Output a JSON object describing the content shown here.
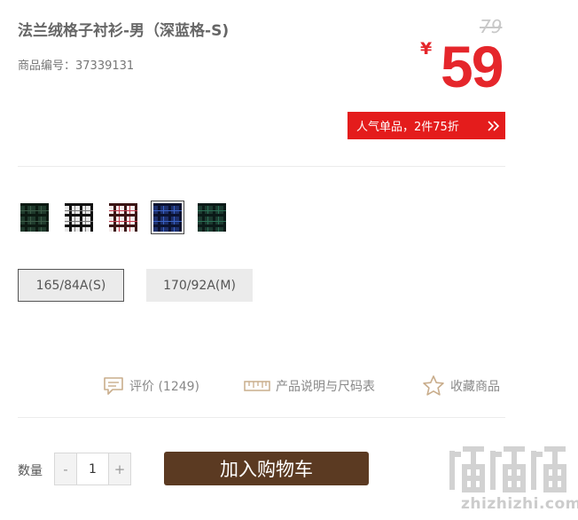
{
  "product": {
    "title": "法兰绒格子衬衫-男（深蓝格-S)",
    "sku_label": "商品编号：37339131"
  },
  "price": {
    "original": "79",
    "currency_symbol": "¥",
    "current": "59",
    "promo_text": "人气单品，2件75折"
  },
  "colors": {
    "swatches": [
      {
        "name": "dark-green-plaid",
        "base": "#1f3a2c",
        "line": "#0c1a12",
        "accent": "#3b5b46"
      },
      {
        "name": "black-white-plaid",
        "base": "#e8e8e8",
        "line": "#111111",
        "accent": "#777777"
      },
      {
        "name": "red-white-plaid",
        "base": "#f3ecec",
        "line": "#3b1515",
        "accent": "#c0394a"
      },
      {
        "name": "navy-blue-plaid",
        "base": "#1d2f6b",
        "line": "#0b1230",
        "accent": "#3a63c6"
      },
      {
        "name": "green-navy-plaid",
        "base": "#1c3a30",
        "line": "#0b1a18",
        "accent": "#2a6e53"
      }
    ],
    "selected_index": 3
  },
  "sizes": {
    "options": [
      "165/84A(S)",
      "170/92A(M)"
    ],
    "selected_index": 0
  },
  "actions": {
    "reviews": "评价 (1249)",
    "size_chart": "产品说明与尺码表",
    "favorite": "收藏商品"
  },
  "purchase": {
    "qty_label": "数量",
    "minus": "-",
    "qty_value": "1",
    "plus": "+",
    "add_to_cart": "加入购物车"
  },
  "watermark": {
    "text": "zhizhizhi.com",
    "mark_color": "#d2d2d2"
  },
  "theme": {
    "accent_red": "#e5262b",
    "promo_red": "#e41c1c",
    "cart_brown": "#5b3a22",
    "icon_tan": "#c9ad8c"
  }
}
